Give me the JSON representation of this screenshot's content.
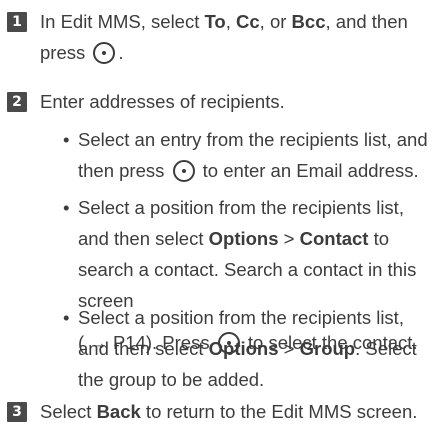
{
  "steps": [
    {
      "number": "1",
      "parts": [
        "In Edit MMS, select ",
        "To",
        ", ",
        "Cc",
        ", or ",
        "Bcc",
        ", and then press ",
        "."
      ]
    },
    {
      "number": "2",
      "text": "Enter addresses of recipients.",
      "bullets": [
        {
          "marker": "•",
          "parts": [
            "Select an entry from the recipients list, and then press ",
            " to enter an Email address."
          ]
        },
        {
          "marker": "•",
          "parts": [
            "Select a position from the recipients list,  and then select ",
            "Options",
            " > ",
            "Contact",
            " to search a contact. Search a contact in this screen",
            "( → P14). Press ",
            " to select the contact."
          ]
        },
        {
          "marker": "•",
          "parts": [
            "Select a position from the recipients list,  and then select ",
            "Options",
            " > ",
            "Group",
            ". Select the group to be added."
          ]
        }
      ]
    },
    {
      "number": "3",
      "parts": [
        "Select ",
        "Back",
        " to return to the Edit MMS screen."
      ]
    }
  ]
}
